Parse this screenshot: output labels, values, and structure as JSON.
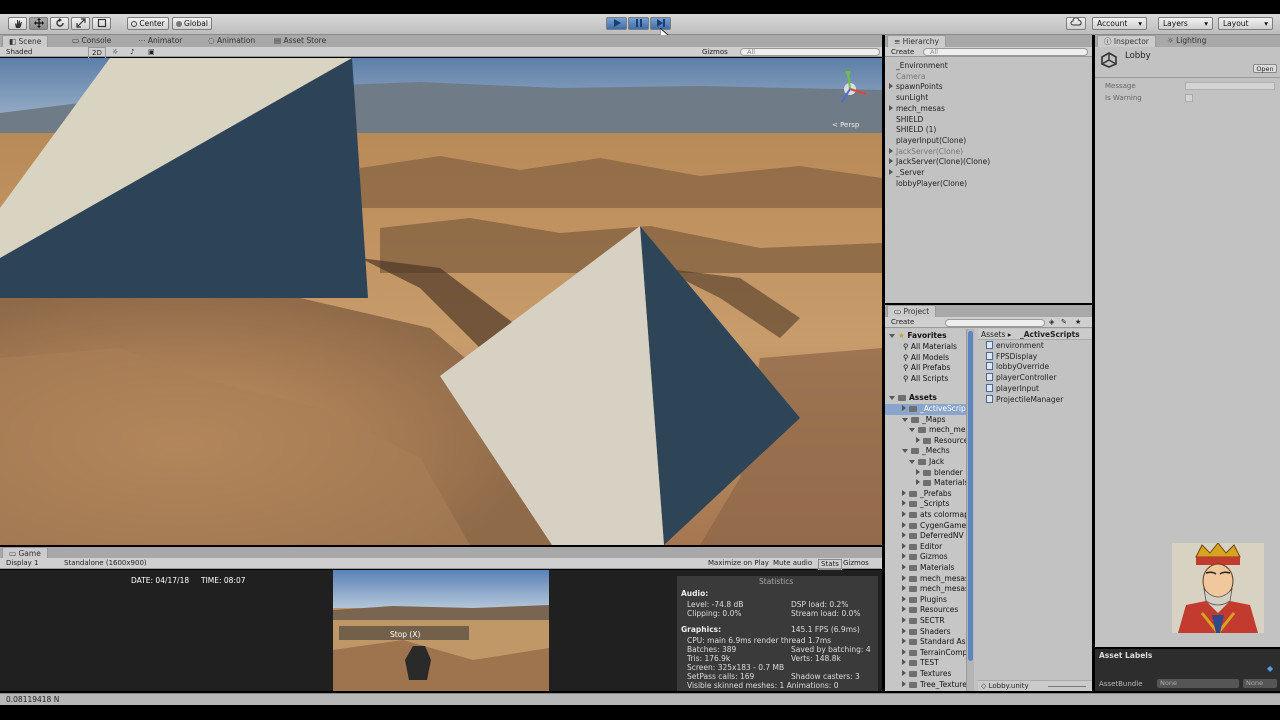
{
  "toolbar": {
    "pivot_label": "Center",
    "space_label": "Global",
    "account_label": "Account",
    "layers_label": "Layers",
    "layout_label": "Layout"
  },
  "scene_tabs": {
    "scene": "Scene",
    "console": "Console",
    "animator": "Animator",
    "animation": "Animation",
    "asset_store": "Asset Store",
    "shaded": "Shaded",
    "mode_2d": "2D",
    "gizmos": "Gizmos",
    "search_placeholder": "All",
    "persp": "< Persp"
  },
  "hierarchy": {
    "title": "Hierarchy",
    "create_label": "Create",
    "search_placeholder": "All",
    "items": [
      {
        "label": "_Environment",
        "expandable": false,
        "dim": false
      },
      {
        "label": "Camera",
        "expandable": false,
        "dim": true
      },
      {
        "label": "spawnPoints",
        "expandable": true,
        "dim": false
      },
      {
        "label": "sunLight",
        "expandable": false,
        "dim": false
      },
      {
        "label": "mech_mesas",
        "expandable": true,
        "dim": false
      },
      {
        "label": "SHIELD",
        "expandable": false,
        "dim": false
      },
      {
        "label": "SHIELD (1)",
        "expandable": false,
        "dim": false
      },
      {
        "label": "playerInput(Clone)",
        "expandable": false,
        "dim": false
      },
      {
        "label": "JackServer(Clone)",
        "expandable": true,
        "dim": true
      },
      {
        "label": "JackServer(Clone)(Clone)",
        "expandable": true,
        "dim": false
      },
      {
        "label": "_Server",
        "expandable": true,
        "dim": false
      },
      {
        "label": "lobbyPlayer(Clone)",
        "expandable": false,
        "dim": false
      }
    ]
  },
  "inspector": {
    "title": "Inspector",
    "lighting_tab": "Lighting",
    "object_name": "Lobby",
    "open_label": "Open",
    "message_label": "Message",
    "is_warning_label": "Is Warning"
  },
  "project": {
    "title": "Project",
    "create_label": "Create",
    "favorites_label": "Favorites",
    "favorites": [
      "All Materials",
      "All Models",
      "All Prefabs",
      "All Scripts"
    ],
    "assets_label": "Assets",
    "tree": [
      {
        "label": "_ActiveScripts",
        "indent": 1,
        "open": false,
        "selected": true
      },
      {
        "label": "_Maps",
        "indent": 1,
        "open": true,
        "selected": false
      },
      {
        "label": "mech_mesas",
        "indent": 2,
        "open": true,
        "selected": false
      },
      {
        "label": "Resources",
        "indent": 3,
        "open": false,
        "selected": false
      },
      {
        "label": "_Mechs",
        "indent": 1,
        "open": true,
        "selected": false
      },
      {
        "label": "Jack",
        "indent": 2,
        "open": true,
        "selected": false
      },
      {
        "label": "blender",
        "indent": 3,
        "open": false,
        "selected": false
      },
      {
        "label": "Materials",
        "indent": 3,
        "open": false,
        "selected": false
      },
      {
        "label": "_Prefabs",
        "indent": 1,
        "open": false,
        "selected": false
      },
      {
        "label": "_Scripts",
        "indent": 1,
        "open": false,
        "selected": false
      },
      {
        "label": "ats colormap",
        "indent": 1,
        "open": false,
        "selected": false
      },
      {
        "label": "CygenGames",
        "indent": 1,
        "open": false,
        "selected": false
      },
      {
        "label": "DeferredNV",
        "indent": 1,
        "open": false,
        "selected": false
      },
      {
        "label": "Editor",
        "indent": 1,
        "open": false,
        "selected": false
      },
      {
        "label": "Gizmos",
        "indent": 1,
        "open": false,
        "selected": false
      },
      {
        "label": "Materials",
        "indent": 1,
        "open": false,
        "selected": false
      },
      {
        "label": "mech_mesas",
        "indent": 1,
        "open": false,
        "selected": false
      },
      {
        "label": "mech_mesas_",
        "indent": 1,
        "open": false,
        "selected": false
      },
      {
        "label": "Plugins",
        "indent": 1,
        "open": false,
        "selected": false
      },
      {
        "label": "Resources",
        "indent": 1,
        "open": false,
        "selected": false
      },
      {
        "label": "SECTR",
        "indent": 1,
        "open": false,
        "selected": false
      },
      {
        "label": "Shaders",
        "indent": 1,
        "open": false,
        "selected": false
      },
      {
        "label": "Standard Ass",
        "indent": 1,
        "open": false,
        "selected": false
      },
      {
        "label": "TerrainComp",
        "indent": 1,
        "open": false,
        "selected": false
      },
      {
        "label": "TEST",
        "indent": 1,
        "open": false,
        "selected": false
      },
      {
        "label": "Textures",
        "indent": 1,
        "open": false,
        "selected": false
      },
      {
        "label": "Tree_Texture",
        "indent": 1,
        "open": false,
        "selected": false
      }
    ],
    "breadcrumb_root": "Assets ▸",
    "breadcrumb_current": "_ActiveScripts",
    "files": [
      "environment",
      "FPSDisplay",
      "lobbyOverride",
      "playerController",
      "playerInput",
      "ProjectileManager"
    ],
    "footer_file": "Lobby.unity"
  },
  "game": {
    "title": "Game",
    "display": "Display 1",
    "resolution": "Standalone (1600x900)",
    "maximize": "Maximize on Play",
    "mute": "Mute audio",
    "stats": "Stats",
    "gizmos": "Gizmos",
    "date_text": "DATE: 04/17/18",
    "time_text": "TIME: 08:07",
    "stop_label": "Stop (X)"
  },
  "stats": {
    "title": "Statistics",
    "audio_label": "Audio:",
    "level": "Level: -74.8 dB",
    "clipping": "Clipping: 0.0%",
    "dsp": "DSP load: 0.2%",
    "stream": "Stream load: 0.0%",
    "graphics_label": "Graphics:",
    "fps": "145.1 FPS (6.9ms)",
    "cpu": "CPU: main 6.9ms  render thread 1.7ms",
    "batches": "Batches: 389",
    "saved": "Saved by batching: 4",
    "tris": "Tris: 176.9k",
    "verts": "Verts: 148.8k",
    "screen": "Screen: 325x183 - 0.7 MB",
    "setpass": "SetPass calls: 169",
    "shadow": "Shadow casters: 3",
    "skinned": "Visible skinned meshes: 1  Animations: 0"
  },
  "asset_labels": {
    "title": "Asset Labels",
    "bundle_label": "AssetBundle",
    "none1": "None",
    "none2": "None"
  },
  "status_bar": {
    "text": "0.08119418 N"
  }
}
